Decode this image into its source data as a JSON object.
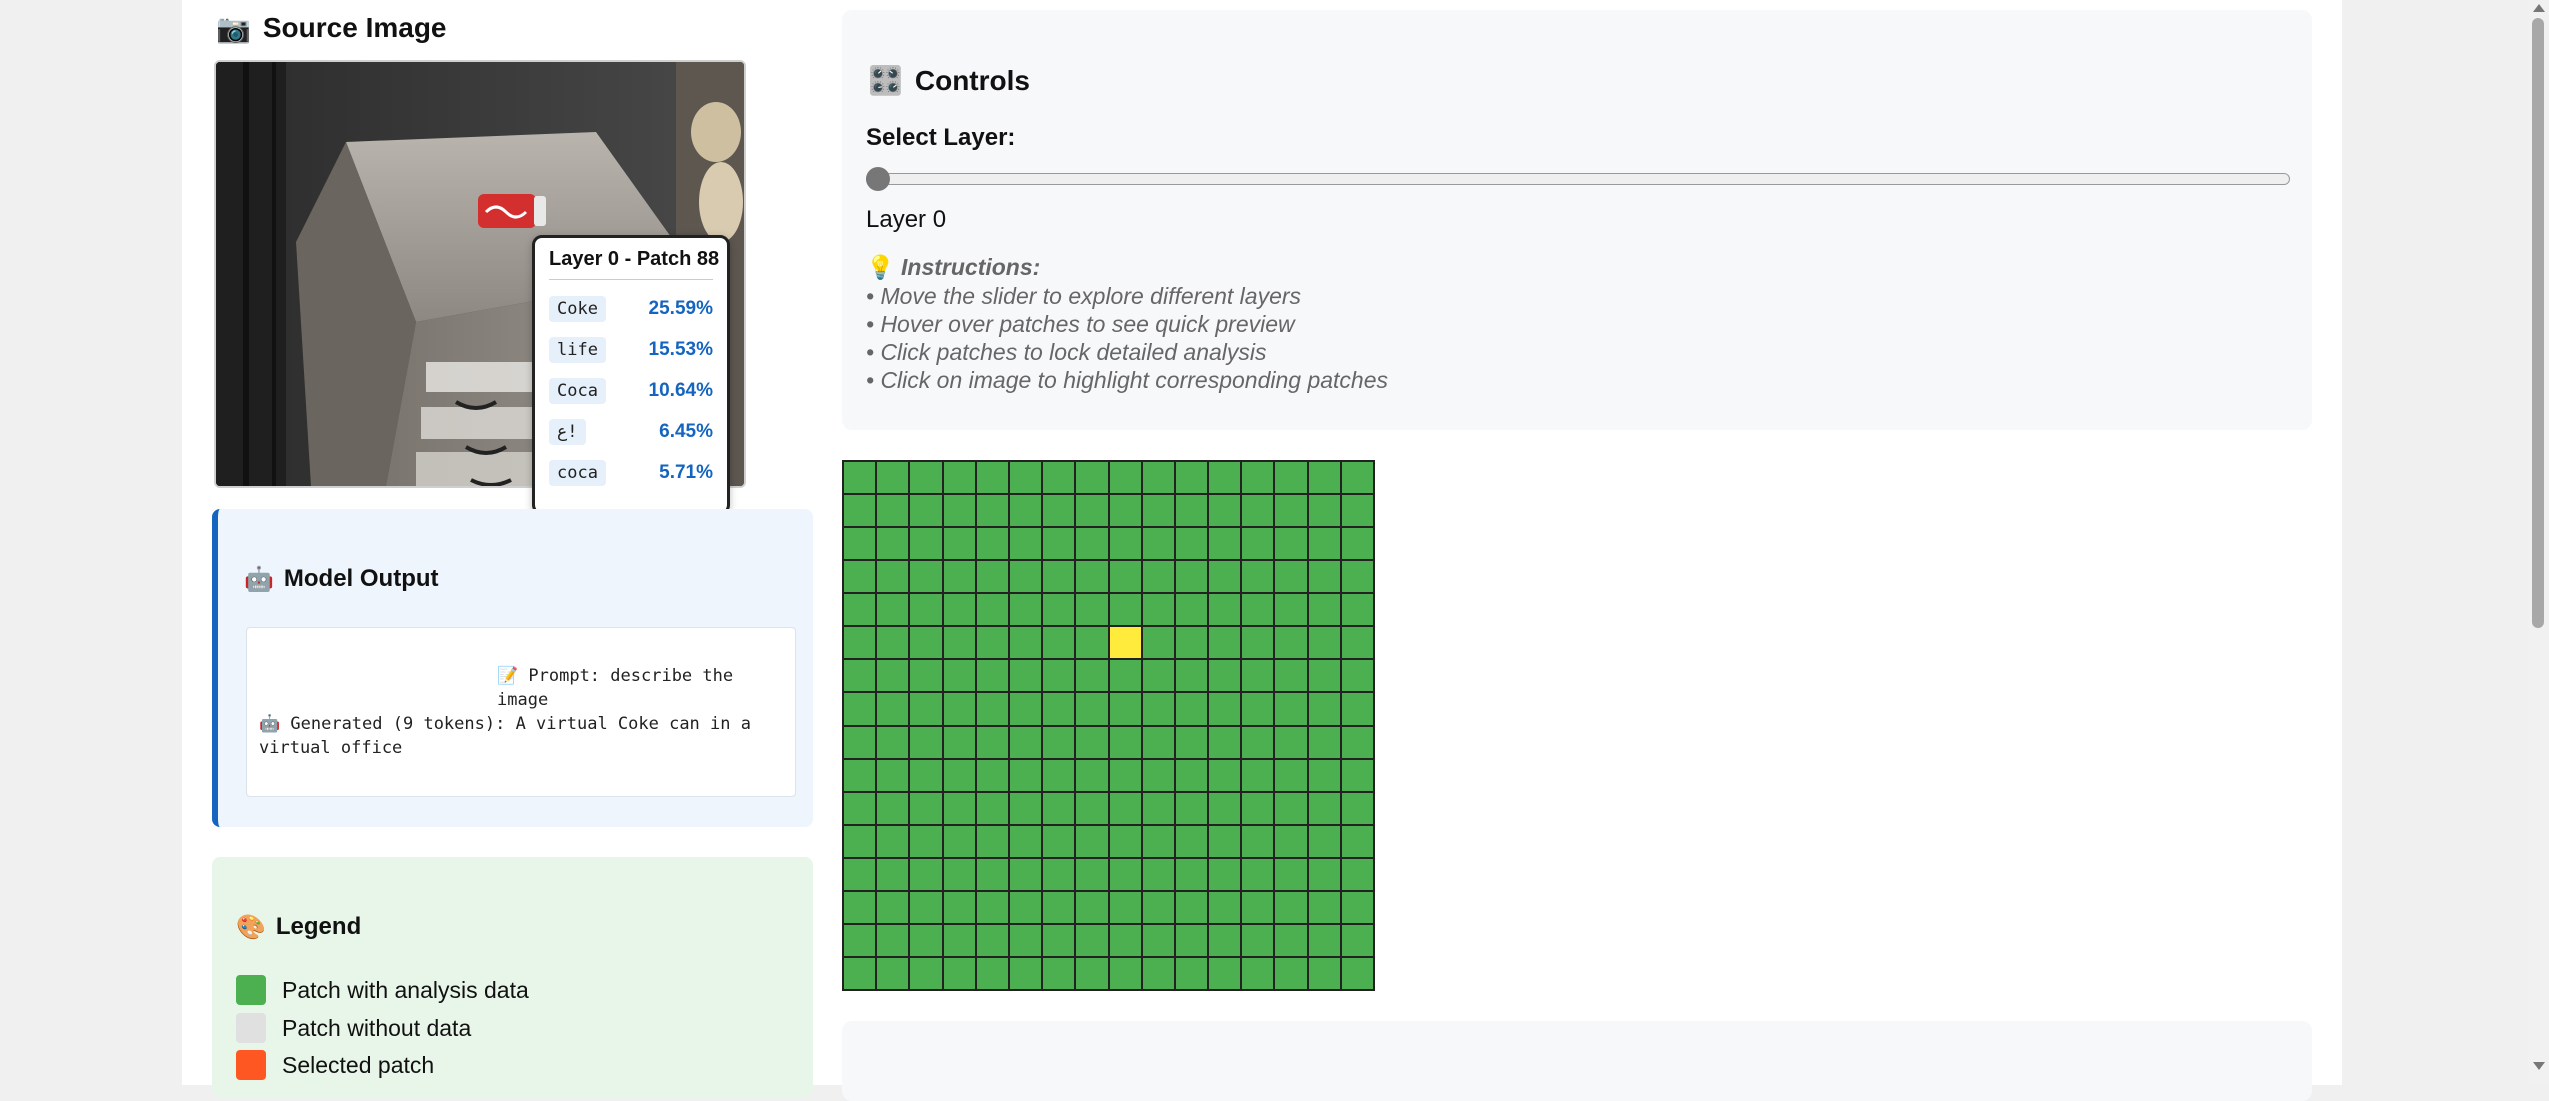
{
  "source": {
    "title": "Source Image",
    "icon": "camera-icon"
  },
  "tooltip": {
    "title": "Layer 0 - Patch 88",
    "tokens": [
      {
        "token": "Coke",
        "prob": "25.59%"
      },
      {
        "token": "life",
        "prob": "15.53%"
      },
      {
        "token": "Coca",
        "prob": "10.64%"
      },
      {
        "token": "ع!",
        "prob": "6.45%"
      },
      {
        "token": "coca",
        "prob": "5.71%"
      }
    ]
  },
  "model_output": {
    "title": "Model Output",
    "icon": "robot-icon",
    "prompt": "📝 Prompt: describe the image",
    "generated": "🤖 Generated (9 tokens): A virtual Coke can in a virtual office"
  },
  "legend": {
    "title": "Legend",
    "icon": "palette-icon",
    "items": [
      {
        "label": "Patch with analysis data",
        "color": "#4caf50"
      },
      {
        "label": "Patch without data",
        "color": "#e0e0e0"
      },
      {
        "label": "Selected patch",
        "color": "#ff5722"
      }
    ]
  },
  "controls": {
    "title": "Controls",
    "icon": "control-knobs-icon",
    "select_label": "Select Layer:",
    "layer_value": "Layer 0",
    "slider": {
      "min": 0,
      "max": 31,
      "value": 0
    },
    "instructions_title": "Instructions:",
    "instructions": [
      "• Move the slider to explore different layers",
      "• Hover over patches to see quick preview",
      "• Click patches to lock detailed analysis",
      "• Click on image to highlight corresponding patches"
    ]
  },
  "grid": {
    "rows": 16,
    "cols": 16,
    "highlight_row": 5,
    "highlight_col": 8,
    "cell_color": "#4caf50",
    "highlight_color": "#ffeb3b"
  }
}
